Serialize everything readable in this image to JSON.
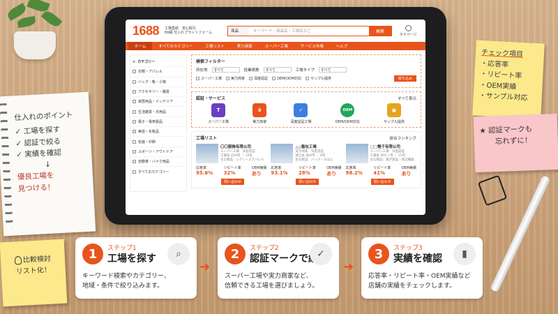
{
  "tablet": {
    "logo": "1688",
    "tagline1": "工場直結　安心取引",
    "tagline2": "Bb級 仕入れプラットフォーム",
    "search_category": "商品",
    "search_placeholder": "キーワード・商品名・工場名など",
    "search_button": "検索",
    "mypage": "マイページ",
    "nav": [
      "ホーム",
      "すべてのカテゴリー",
      "工場リスト",
      "実力商家",
      "スーパー工場",
      "サービス市場",
      "ヘルプ"
    ],
    "sidebar_title": "カテゴリー",
    "sidebar": [
      "衣類・アパレル",
      "バッグ・靴・小物",
      "アクセサリー・雑貨",
      "家居用品・インテリア",
      "生活雑貨・日用品",
      "電子・電気製品",
      "美容・化粧品",
      "包装・印刷",
      "スポーツ・アウトドア",
      "自動車・バイク用品"
    ],
    "sidebar_all": "すべてのカテゴリー",
    "filter": {
      "title": "検索フィルター",
      "fields": [
        {
          "label": "所在地",
          "value": "すべて"
        },
        {
          "label": "従業員数",
          "value": "すべて"
        },
        {
          "label": "工場タイプ",
          "value": "すべて"
        }
      ],
      "checks": [
        "スーパー工場",
        "実力商家",
        "深度認証",
        "OEM/ODM対応",
        "サンプル提供"
      ],
      "button": "絞り込み"
    },
    "cert": {
      "title": "認証・サービス",
      "more": "すべて表示",
      "items": [
        {
          "label": "スーパー工場",
          "glyph": "T",
          "color": "#6a3fc1"
        },
        {
          "label": "実力商家",
          "glyph": "♛",
          "color": "#e8541c"
        },
        {
          "label": "深度認証工場",
          "glyph": "✓",
          "color": "#3d7fe0"
        },
        {
          "label": "OEM/ODM対応",
          "glyph": "OEM",
          "color": "#22a55a"
        },
        {
          "label": "サンプル提供",
          "glyph": "▣",
          "color": "#e8a31c"
        }
      ]
    },
    "factory": {
      "title": "工場リスト",
      "sort": "総合ランキング",
      "stat_labels": [
        "応答率",
        "リピート率",
        "OEM実績"
      ],
      "ask": "問い合わせ",
      "cards": [
        {
          "name": "〇〇服飾有限公司",
          "tags": "スーパー工場　深度認証",
          "meta": "工業省 広州市 ｜ 10年",
          "goods": "主な製品：レディースアパレル",
          "r1": "95.6%",
          "r2": "32%",
          "r3": "あり"
        },
        {
          "name": "△△箱包工場",
          "tags": "実力商家　深度認証",
          "meta": "浙江省 温州市 ｜ 8年",
          "goods": "主な製品：バッグ・かばん",
          "r1": "93.1%",
          "r2": "28%",
          "r3": "あり"
        },
        {
          "name": "□□電子有限公司",
          "tags": "スーパー工場　深度認証",
          "meta": "工業省 深セン市 ｜ 15年",
          "goods": "主な製品：電子部品・周辺機器",
          "r1": "98.2%",
          "r2": "41%",
          "r3": "あり"
        }
      ]
    }
  },
  "notebook": {
    "title": "仕入れのポイント",
    "items": [
      "✓ 工場を探す",
      "✓ 認証で絞る",
      "✓ 実績を確認"
    ],
    "arrow": "↓",
    "conclusion1": "優良工場を",
    "conclusion2": "見つける！"
  },
  "yellow_note": {
    "title": "チェック項目",
    "items": [
      "・応答率",
      "・リピート率",
      "・OEM実績",
      "・サンプル対応"
    ]
  },
  "pink_note": {
    "line1": "★ 認証マークも",
    "line2": "忘れずに！"
  },
  "bottom_note": {
    "line1": "比較検討",
    "line2": "リスト化！"
  },
  "steps": [
    {
      "num": "1",
      "label": "ステップ1",
      "heading": "工場を探す",
      "icon": "search-icon",
      "glyph": "⌕",
      "desc1": "キーワード検索やカテゴリー、",
      "desc2": "地域・条件で絞り込みます。"
    },
    {
      "num": "2",
      "label": "ステップ2",
      "heading": "認証マークで絞る",
      "icon": "shield-check-icon",
      "glyph": "✓",
      "desc1": "スーパー工場や実力商家など、",
      "desc2": "信頼できる工場を選びましょう。"
    },
    {
      "num": "3",
      "label": "ステップ3",
      "heading": "実績を確認",
      "icon": "bar-chart-icon",
      "glyph": "▮",
      "desc1": "応答率・リピート率・OEM実績など",
      "desc2": "店舗の実績をチェックします。"
    }
  ]
}
